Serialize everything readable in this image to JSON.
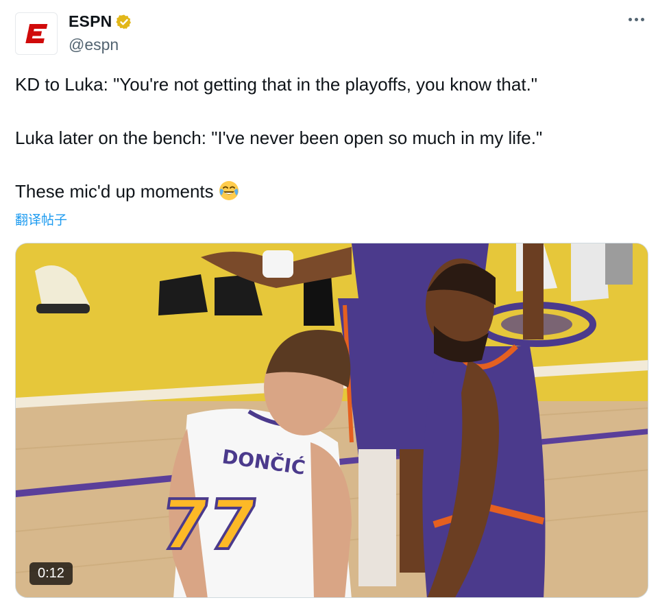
{
  "account": {
    "display_name": "ESPN",
    "handle": "@espn",
    "avatar_letter": "E",
    "verified": true
  },
  "tweet": {
    "lines": [
      "KD to Luka: \"You're not getting that in the playoffs, you know that.\"",
      "Luka later on the bench: \"I've never been open so much in my life.\"",
      "These mic'd up moments"
    ],
    "emoji": "face-with-tears-of-joy",
    "translate_label": "翻译帖子"
  },
  "media": {
    "duration": "0:12",
    "jersey_name": "DONČIĆ",
    "jersey_number": "77"
  },
  "colors": {
    "espn_red": "#d00a0a",
    "link_blue": "#1d9bf0",
    "verified_gold": "#e2b719",
    "suns_purple": "#4b3a8c",
    "lakers_gold": "#fdb927"
  }
}
